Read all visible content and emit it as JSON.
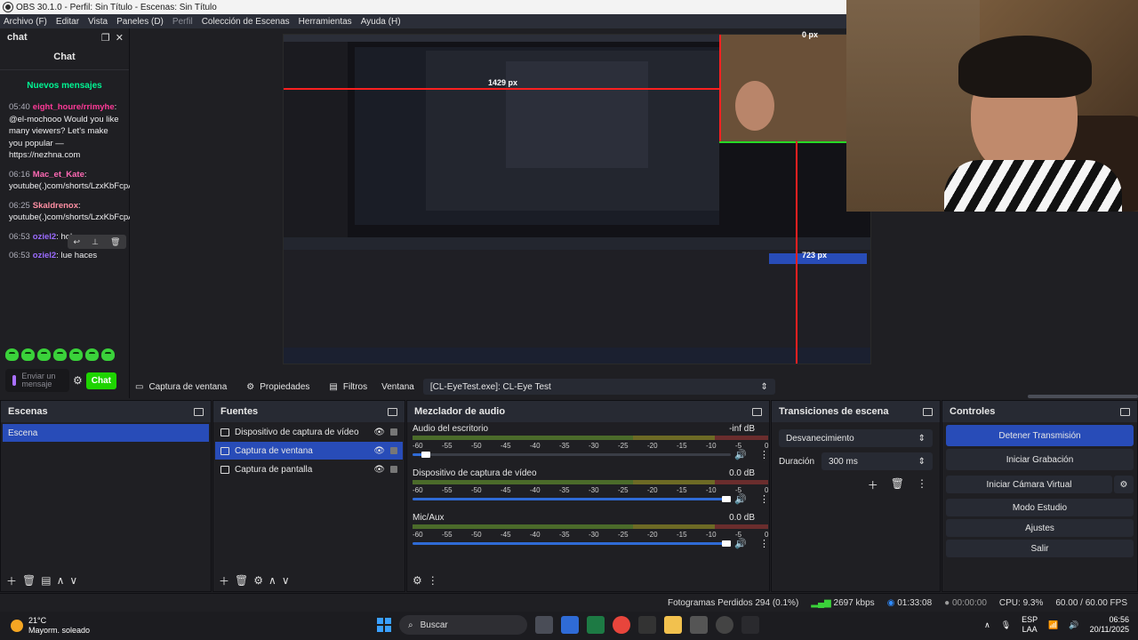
{
  "window": {
    "title": "OBS 30.1.0 - Perfil: Sin Título - Escenas: Sin Título"
  },
  "menu": [
    "Archivo (F)",
    "Editar",
    "Vista",
    "Paneles (D)",
    "Perfil",
    "Colección de Escenas",
    "Herramientas",
    "Ayuda (H)"
  ],
  "chat": {
    "dock_title": "chat",
    "header": "Chat",
    "new_messages": "Nuevos mensajes",
    "messages": [
      {
        "time": "05:40",
        "user": "eight_houre/rrimyhe",
        "text": ": @el-mochooo Would you like many viewers? Let's make you popular — https://nezhna.com"
      },
      {
        "time": "06:16",
        "user": "Mac_et_Kate",
        "text": ": youtube(.)com/shorts/LzxKbFcpAkc"
      },
      {
        "time": "06:25",
        "user": "Skaldrenox",
        "text": ": youtube(.)com/shorts/LzxKbFcpAkc"
      },
      {
        "time": "06:53",
        "user": "oziel2",
        "text": ": hola"
      },
      {
        "time": "06:53",
        "user": "oziel2",
        "text": ": lue haces"
      }
    ],
    "input_placeholder": "Enviar un mensaje",
    "chat_button": "Chat"
  },
  "preview": {
    "label_top": "0 px",
    "label_left": "1429 px",
    "label_bottom": "723 px"
  },
  "context": {
    "source_name": "Captura de ventana",
    "properties": "Propiedades",
    "filters": "Filtros",
    "window_label": "Ventana",
    "window_value": "[CL-EyeTest.exe]: CL-Eye Test"
  },
  "scenes": {
    "title": "Escenas",
    "items": [
      "Escena"
    ]
  },
  "sources": {
    "title": "Fuentes",
    "items": [
      "Dispositivo de captura de vídeo",
      "Captura de ventana",
      "Captura de pantalla"
    ]
  },
  "mixer": {
    "title": "Mezclador de audio",
    "channels": [
      {
        "name": "Audio del escritorio",
        "level": "-inf dB",
        "volume": 0.03
      },
      {
        "name": "Dispositivo de captura de vídeo",
        "level": "0.0 dB",
        "volume": 1.0
      },
      {
        "name": "Mic/Aux",
        "level": "0.0 dB",
        "volume": 1.0
      }
    ],
    "ticks": [
      "-60",
      "-55",
      "-50",
      "-45",
      "-40",
      "-35",
      "-30",
      "-25",
      "-20",
      "-15",
      "-10",
      "-5",
      "0"
    ]
  },
  "transitions": {
    "title": "Transiciones de escena",
    "selected": "Desvanecimiento",
    "duration_label": "Duración",
    "duration_value": "300 ms"
  },
  "controls": {
    "title": "Controles",
    "stop_stream": "Detener Transmisión",
    "start_recording": "Iniciar Grabación",
    "start_virtual_cam": "Iniciar Cámara Virtual",
    "studio_mode": "Modo Estudio",
    "settings": "Ajustes",
    "exit": "Salir"
  },
  "status": {
    "dropped_frames": "Fotogramas Perdidos 294 (0.1%)",
    "bitrate": "2697 kbps",
    "stream_time": "01:33:08",
    "rec_time": "00:00:00",
    "cpu": "CPU: 9.3%",
    "fps": "60.00 / 60.00 FPS"
  },
  "taskbar": {
    "temperature": "21°C",
    "weather": "Mayorm. soleado",
    "search_placeholder": "Buscar",
    "lang": "ESP",
    "lang_sub": "LAA",
    "time": "06:56",
    "date": "20/11/2025"
  },
  "colors": {
    "accent": "#284cb8",
    "twitch_green": "#00f593",
    "chat_button": "#1ed400"
  }
}
